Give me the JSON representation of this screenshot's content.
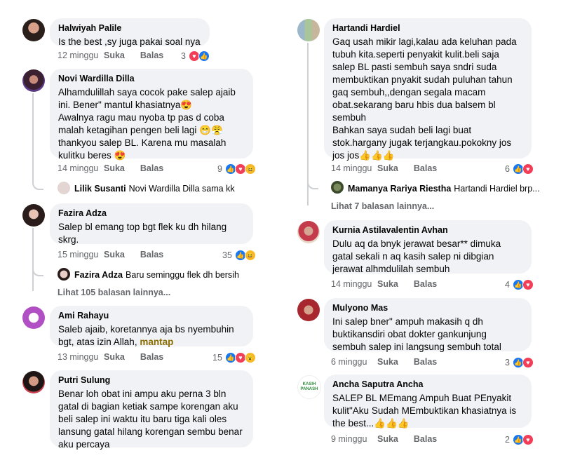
{
  "left": [
    {
      "name": "Halwiyah Palile",
      "text": "Is the best ,sy juga pakai soal nya",
      "time": "12 minggu",
      "like": "Suka",
      "reply": "Balas",
      "count": "3",
      "reactions": [
        "love",
        "like"
      ]
    },
    {
      "name": "Novi Wardilla Dilla",
      "text": "Alhamdulillah saya cocok pake salep ajaib\nini. Bener\" mantul khasiatnya😍\nAwalnya ragu mau nyoba tp pas d coba\nmalah ketagihan pengen beli lagi 😁😤\nthankyou salep BL. Karena mu masalah\nkulitku beres 😍",
      "time": "14 minggu",
      "like": "Suka",
      "reply": "Balas",
      "count": "9",
      "reactions": [
        "like",
        "love",
        "haha"
      ],
      "reply_preview": {
        "name": "Lilik Susanti",
        "text": "Novi Wardilla Dilla sama kk"
      }
    },
    {
      "name": "Fazira Adza",
      "text": "Salep bl emang top bgt flek ku dh hilang\nskrg.",
      "time": "15 minggu",
      "like": "Suka",
      "reply": "Balas",
      "count": "35",
      "reactions": [
        "like",
        "haha"
      ],
      "reply_preview": {
        "name": "Fazira Adza",
        "text": "Baru seminggu flek dh bersih"
      },
      "more_replies": "Lihat 105 balasan lainnya..."
    },
    {
      "name": "Ami Rahayu",
      "text": "Saleb ajaib, koretannya aja bs nyembuhin\nbgt, atas izin Allah,",
      "mention": "mantap",
      "time": "13 minggu",
      "like": "Suka",
      "reply": "Balas",
      "count": "15",
      "reactions": [
        "like",
        "love",
        "wow"
      ]
    },
    {
      "name": "Putri Sulung",
      "text": "Benar loh obat ini ampu aku perna 3 bln\ngatal di bagian ketiak sampe korengan aku\nbeli salep ini waktu itu baru tiga kali oles\nlansung gatal hilang korengan sembu benar\naku percaya",
      "time": "",
      "like": "",
      "reply": "",
      "count": "",
      "reactions": []
    }
  ],
  "right": [
    {
      "name": "Hartandi Hardiel",
      "text": "Gaq usah mikir lagi,kalau ada keluhan pada\ntubuh kita.seperti penyakit kulit.beli saja\nsalep BL pasti sembuh saya sndri suda\nmembuktikan pnyakit sudah puluhan tahun\ngaq sembuh,,dengan segala macam\nobat.sekarang baru hbis dua balsem bl\nsembuh\nBahkan saya sudah beli lagi buat\nstok.hargany jugak terjangkau.pokokny jos\njos jos👍👍👍",
      "time": "14 minggu",
      "like": "Suka",
      "reply": "Balas",
      "count": "6",
      "reactions": [
        "like",
        "love"
      ],
      "reply_preview": {
        "name": "Mamanya Rariya Riestha",
        "text": "Hartandi Hardiel brp..."
      },
      "more_replies": "Lihat 7 balasan lainnya..."
    },
    {
      "name": "Kurnia Astilavalentin Avhan",
      "text": "Dulu aq da bnyk jerawat besar** dimuka\ngatal sekali n aq kasih salep ni dibgian\njerawat alhmdulilah sembuh",
      "time": "14 minggu",
      "like": "Suka",
      "reply": "Balas",
      "count": "4",
      "reactions": [
        "like",
        "love"
      ]
    },
    {
      "name": "Mulyono Mas",
      "text": "Ini salep bner\" ampuh makasih q dh\nbuktikansdiri obat dokter gankunjung\nsembuh salep ini langsung sembuh total",
      "time": "6 minggu",
      "like": "Suka",
      "reply": "Balas",
      "count": "3",
      "reactions": [
        "like",
        "love"
      ]
    },
    {
      "name": "Ancha Saputra Ancha",
      "text": "SALEP BL MEmang Ampuh Buat PEnyakit\nkulit\"Aku Sudah MEmbuktikan khasiatnya is\nthe best...👍👍👍",
      "time": "9 minggu",
      "like": "Suka",
      "reply": "Balas",
      "count": "2",
      "reactions": [
        "like",
        "love"
      ],
      "avatar_text": "KASIH PANASH"
    }
  ],
  "colors": {
    "bubble": "#f0f2f5",
    "meta": "#65676b",
    "like": "#1877f2",
    "love": "#f33e58",
    "haha": "#f7b928",
    "mention": "#8a6d00"
  }
}
